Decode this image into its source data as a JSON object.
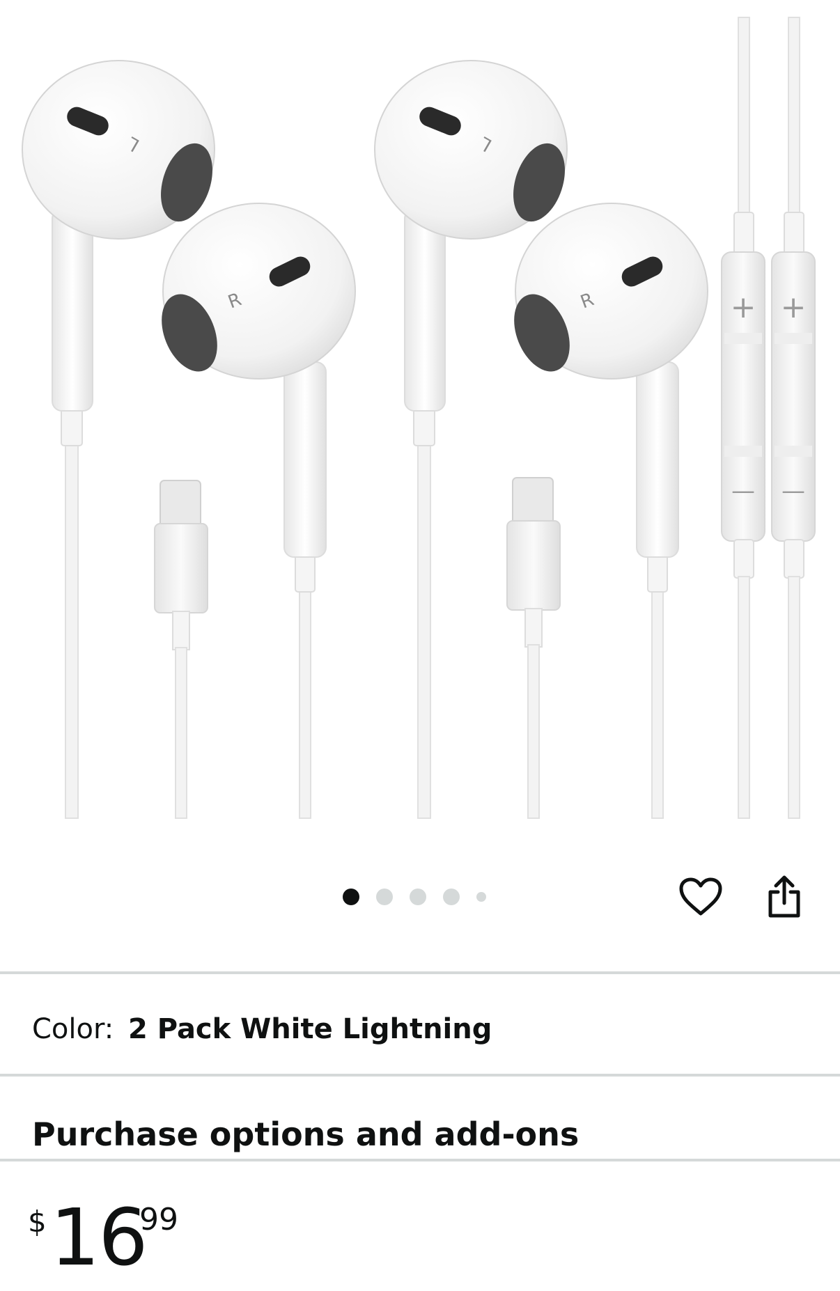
{
  "product_image": {
    "alt": "",
    "earbud_left_mark": "L",
    "earbud_right_mark": "R",
    "remote_plus": "+",
    "remote_minus": "—"
  },
  "carousel": {
    "count": 5,
    "active_index": 0
  },
  "actions": {
    "wishlist_icon": "heart-outline-icon",
    "share_icon": "share-icon"
  },
  "color": {
    "label": "Color:",
    "value": "2 Pack White Lightning"
  },
  "purchase_section": {
    "title": "Purchase options and add-ons"
  },
  "price": {
    "symbol": "$",
    "whole": "16",
    "fraction": "99"
  }
}
